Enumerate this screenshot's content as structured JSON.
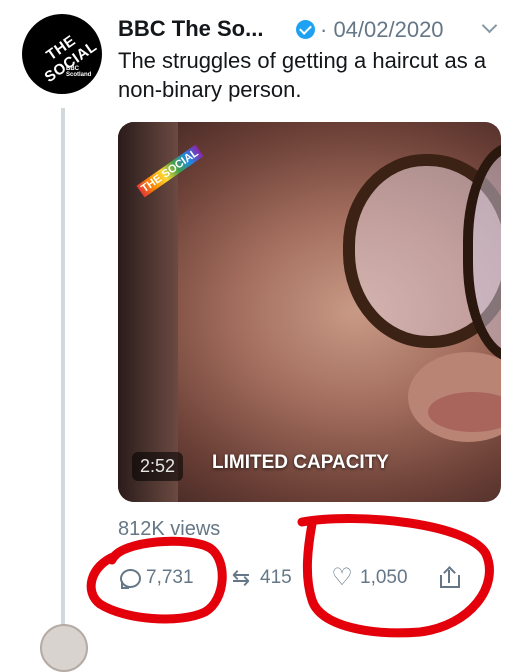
{
  "tweet": {
    "author": "BBC The So...",
    "date": "· 04/02/2020",
    "text": "The struggles of getting a haircut as a non-binary person.",
    "avatar_logo_text": "THE SOCIAL",
    "avatar_logo_sub": "BBC Scotland",
    "media": {
      "logo_text": "THE SOCIAL",
      "duration": "2:52",
      "caption": "LIMITED CAPACITY"
    },
    "views": "812K views",
    "actions": {
      "replies": "7,731",
      "retweets": "415",
      "likes": "1,050"
    }
  },
  "icons": [
    "verified-badge-icon",
    "chevron-down-icon",
    "reply-icon",
    "retweet-icon",
    "heart-icon",
    "share-icon"
  ],
  "colors": {
    "accent": "#1da1f2",
    "muted": "#657786",
    "annotation": "#e3000b"
  }
}
